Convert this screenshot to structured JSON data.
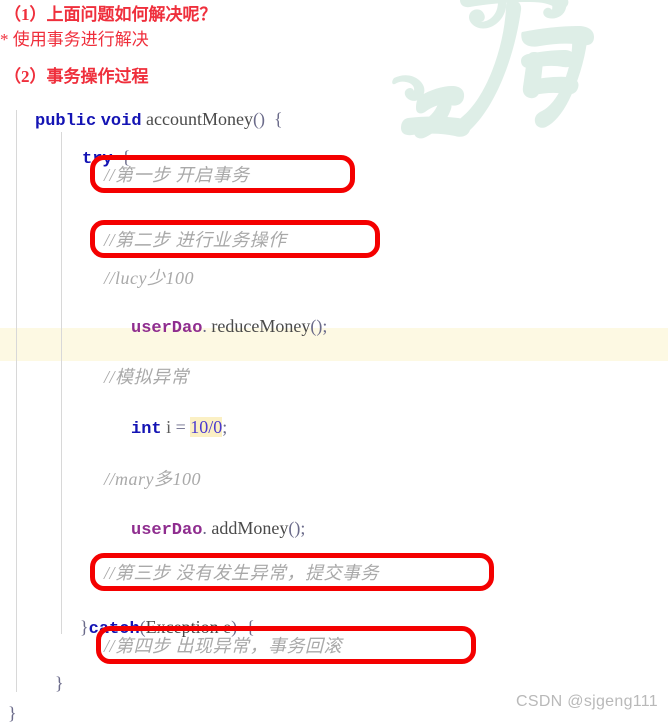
{
  "header": {
    "line1": "（1）上面问题如何解决呢？",
    "line2": "* 使用事务进行解决",
    "line3": "（2）事务操作过程"
  },
  "code": {
    "signature": {
      "kw_public": "public",
      "kw_void": "void",
      "method_name": "accountMoney",
      "parens": "()",
      "open_brace": "{"
    },
    "try_kw": "try",
    "try_brace": "{",
    "comment_step1": "//第一步 开启事务",
    "comment_step2": "//第二步 进行业务操作",
    "comment_lucy": "//lucy少100",
    "stmt_reduce": {
      "object": "userDao",
      "dot": ".",
      "method": "reduceMoney",
      "parens": "()",
      "semi": ";"
    },
    "comment_mock_exception": "//模拟异常",
    "stmt_divide": {
      "kw_int": "int",
      "var": "i",
      "equals": "=",
      "value": "10/0",
      "semi": ";"
    },
    "comment_mary": "//mary多100",
    "stmt_add": {
      "object": "userDao",
      "dot": ".",
      "method": "addMoney",
      "parens": "()",
      "semi": ";"
    },
    "comment_step3": "//第三步 没有发生异常，提交事务",
    "catch_line": {
      "close_brace": "}",
      "kw_catch": "catch",
      "open_paren": "(",
      "exception_type": "Exception",
      "exception_var": "e",
      "close_paren": ")",
      "open_brace": "{"
    },
    "comment_step4": "//第四步 出现异常，事务回滚",
    "close_brace_inner": "}",
    "close_brace_outer": "}"
  },
  "watermark": {
    "footer": "CSDN @sjgeng111",
    "calligraphy_alt": "之石"
  },
  "colors": {
    "header_red": "#ef2f3c",
    "annotation_red": "#f40000",
    "keyword_blue": "#1414b4",
    "field_purple": "#8f2d8f",
    "comment_gray": "#a9a9a9",
    "number_violet": "#4a3ad0",
    "highlight_line": "#fdf9e3",
    "highlight_token": "#fbf0c4",
    "indent_guide": "#d8d8d8",
    "watermark_green": "#ddeee6",
    "footer_gray": "#b9b9b9"
  }
}
